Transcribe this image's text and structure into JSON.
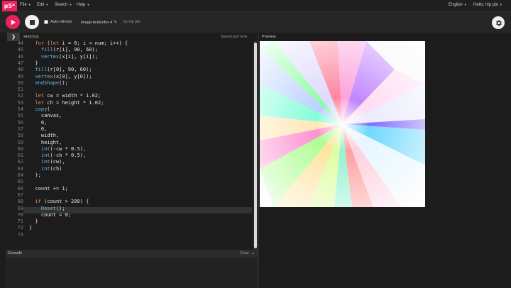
{
  "menubar": {
    "logo": "p5*",
    "items": [
      "File",
      "Edit",
      "Sketch",
      "Help"
    ],
    "language": "English",
    "user": "Hello, hip pbl"
  },
  "toolbar": {
    "auto_refresh": "Auto-refresh",
    "sketch_name": "image-bckbuffer-4",
    "author": "by hip pbl"
  },
  "editor": {
    "file_name": "sketch.js",
    "saved": "Saved just now",
    "lines": [
      {
        "n": "44",
        "t": "  for (let i = 0; i < num; i++) {"
      },
      {
        "n": "45",
        "t": "    fill(r[i], 90, 60);"
      },
      {
        "n": "46",
        "t": "    vertex(x[i], y[i]);"
      },
      {
        "n": "47",
        "t": "  }"
      },
      {
        "n": "48",
        "t": "  fill(r[0], 90, 60);"
      },
      {
        "n": "49",
        "t": "  vertex(x[0], y[0]);"
      },
      {
        "n": "50",
        "t": "  endShape();"
      },
      {
        "n": "51",
        "t": ""
      },
      {
        "n": "52",
        "t": "  let cw = width * 1.02;"
      },
      {
        "n": "53",
        "t": "  let ch = height * 1.02;"
      },
      {
        "n": "54",
        "t": "  copy("
      },
      {
        "n": "55",
        "t": "    canvas,"
      },
      {
        "n": "56",
        "t": "    0,"
      },
      {
        "n": "57",
        "t": "    0,"
      },
      {
        "n": "58",
        "t": "    width,"
      },
      {
        "n": "59",
        "t": "    height,"
      },
      {
        "n": "60",
        "t": "    int(-cw * 0.5),"
      },
      {
        "n": "61",
        "t": "    int(-ch * 0.5),"
      },
      {
        "n": "62",
        "t": "    int(cw),"
      },
      {
        "n": "63",
        "t": "    int(ch)"
      },
      {
        "n": "64",
        "t": "  );"
      },
      {
        "n": "65",
        "t": ""
      },
      {
        "n": "66",
        "t": "  count += 1;"
      },
      {
        "n": "67",
        "t": ""
      },
      {
        "n": "68",
        "t": "  if (count > 200) {"
      },
      {
        "n": "69",
        "t": "    Reset();"
      },
      {
        "n": "70",
        "t": "    count = 0;"
      },
      {
        "n": "71",
        "t": "  }"
      },
      {
        "n": "72",
        "t": "}"
      },
      {
        "n": "73",
        "t": ""
      }
    ],
    "highlighted_line": "68"
  },
  "console": {
    "title": "Console",
    "clear": "Clear"
  },
  "preview": {
    "label": "Preview"
  },
  "colors": {
    "brand": "#ed225d",
    "background": "#1c1c1c",
    "keyword": "#ed8a58",
    "function": "#6fb8e3"
  },
  "icons": {
    "play": "play-icon",
    "stop": "stop-icon",
    "settings": "gear-icon",
    "edit": "pencil-icon",
    "sidebar": "chevron-right-icon",
    "console_toggle": "chevron-down-icon"
  }
}
